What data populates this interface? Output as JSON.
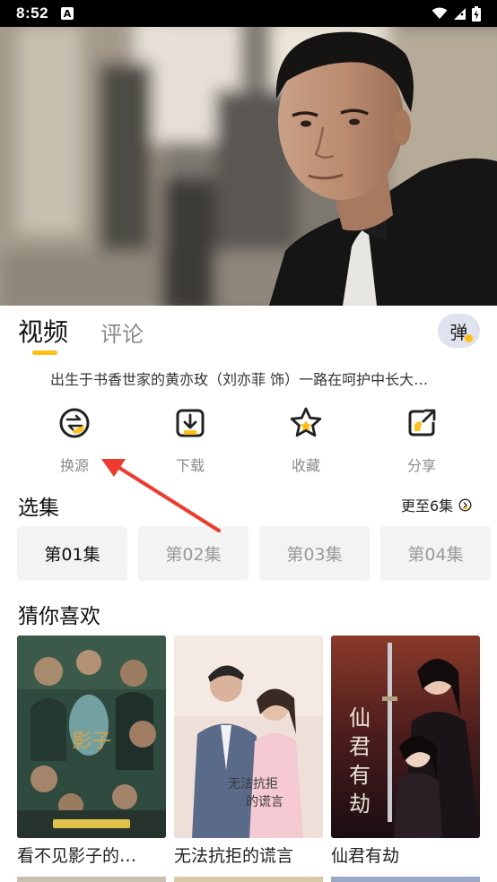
{
  "status_bar": {
    "time": "8:52",
    "notification_icon": "A",
    "icons": [
      "wifi-icon",
      "signal-icon",
      "battery-icon"
    ]
  },
  "player": {
    "state": "playing-frame"
  },
  "tabs": [
    {
      "label": "视频",
      "active": true
    },
    {
      "label": "评论",
      "active": false
    }
  ],
  "danmu_button": {
    "label": "弹"
  },
  "synopsis": "出生于书香世家的黄亦玫（刘亦菲 饰）一路在呵护中长大…",
  "actions": [
    {
      "label": "换源",
      "icon": "switch-source-icon"
    },
    {
      "label": "下载",
      "icon": "download-icon"
    },
    {
      "label": "收藏",
      "icon": "star-icon"
    },
    {
      "label": "分享",
      "icon": "share-icon"
    }
  ],
  "episodes_section": {
    "title": "选集",
    "more_label": "更至6集",
    "episodes": [
      "第01集",
      "第02集",
      "第03集",
      "第04集"
    ],
    "selected_index": 0
  },
  "recommend_section": {
    "title": "猜你喜欢",
    "items": [
      {
        "title": "看不见影子的…"
      },
      {
        "title": "无法抗拒的谎言"
      },
      {
        "title": "仙君有劫"
      }
    ]
  },
  "colors": {
    "accent": "#ffbf14",
    "annotation_arrow": "#f03a2e",
    "chip_bg": "#f3f3f3",
    "muted_text": "#8a8a8a"
  }
}
